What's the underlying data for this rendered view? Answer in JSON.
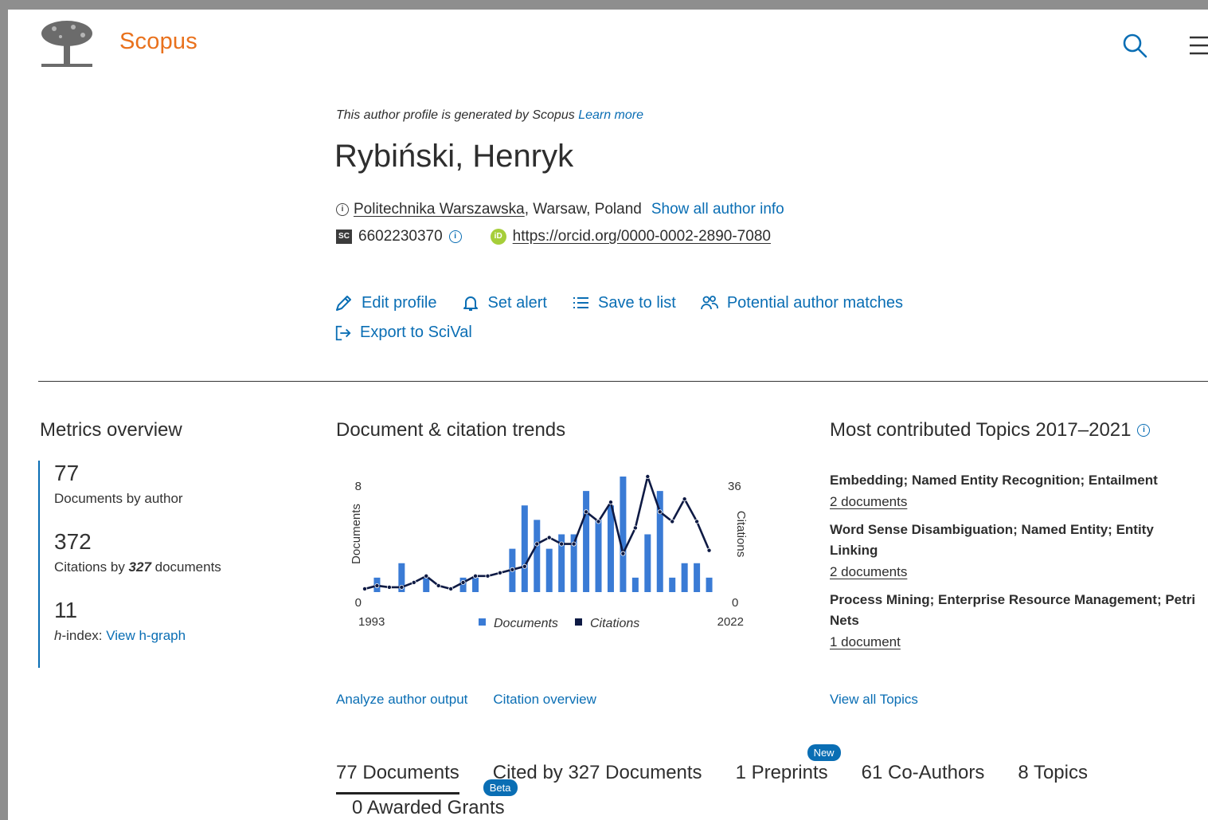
{
  "header": {
    "brand": "Scopus",
    "logo_icon": "elsevier-tree-logo",
    "search_icon": "search-icon",
    "menu_icon": "hamburger-menu-icon"
  },
  "profile": {
    "note": "This author profile is generated by Scopus",
    "learn_more": "Learn more",
    "name": "Rybiński, Henryk",
    "affiliation_link": "Politechnika Warszawska",
    "affiliation_rest": ", Warsaw, Poland",
    "show_all": "Show all author info",
    "scopus_id": "6602230370",
    "orcid": "https://orcid.org/0000-0002-2890-7080"
  },
  "actions": {
    "edit": "Edit profile",
    "alert": "Set alert",
    "save": "Save to list",
    "matches": "Potential author matches",
    "export": "Export to SciVal"
  },
  "metrics": {
    "title": "Metrics overview",
    "documents_value": "77",
    "documents_label": "Documents by author",
    "citations_value": "372",
    "citations_label_pre": "Citations by ",
    "citations_label_num": "327",
    "citations_label_post": " documents",
    "hindex_value": "11",
    "hindex_label_h": "h",
    "hindex_label_rest": "-index: ",
    "hindex_link": "View h-graph"
  },
  "chart_section": {
    "title": "Document & citation trends",
    "analyze_link": "Analyze author output",
    "citation_link": "Citation overview"
  },
  "chart_data": {
    "type": "bar",
    "title": "Document & citation trends",
    "x_start_label": "1993",
    "x_end_label": "2022",
    "years": [
      1993,
      1994,
      1995,
      1996,
      1997,
      1998,
      1999,
      2000,
      2001,
      2002,
      2003,
      2004,
      2005,
      2006,
      2007,
      2008,
      2009,
      2010,
      2011,
      2012,
      2013,
      2014,
      2015,
      2016,
      2017,
      2018,
      2019,
      2020,
      2021,
      2022
    ],
    "series": [
      {
        "name": "Documents",
        "axis": "left",
        "color": "#3a7bd5",
        "values": [
          0,
          1,
          0,
          2,
          0,
          1,
          0,
          0,
          1,
          1,
          0,
          0,
          3,
          6,
          5,
          3,
          4,
          4,
          7,
          5,
          6,
          8,
          1,
          4,
          7,
          1,
          2,
          2,
          1,
          0
        ]
      },
      {
        "name": "Citations",
        "axis": "right",
        "color": "#0e1a44",
        "values": [
          1,
          2,
          1.5,
          1.5,
          3,
          5,
          2,
          1,
          3,
          5,
          5,
          6,
          7,
          8,
          15,
          17,
          15,
          15,
          25,
          22,
          28,
          12,
          20,
          36,
          25,
          22,
          29,
          22,
          13,
          null
        ]
      }
    ],
    "ylabel_left": "Documents",
    "ylabel_right": "Citations",
    "ylim_left": [
      0,
      8
    ],
    "ylim_right": [
      0,
      36
    ],
    "left_ticks": [
      "0",
      "8"
    ],
    "right_ticks": [
      "0",
      "36"
    ],
    "legend": [
      "Documents",
      "Citations"
    ],
    "legend_position": "bottom",
    "grid": false
  },
  "topics": {
    "title": "Most contributed Topics 2017–2021",
    "items": [
      {
        "name": "Embedding; Named Entity Recognition; Entailment",
        "docs": "2 documents"
      },
      {
        "name": "Word Sense Disambiguation; Named Entity; Entity Linking",
        "docs": "2 documents"
      },
      {
        "name": "Process Mining; Enterprise Resource Management; Petri Nets",
        "docs": "1 document"
      }
    ],
    "view_all": "View all Topics"
  },
  "tabs": {
    "documents": "77 Documents",
    "cited_by": "Cited by 327 Documents",
    "preprints": "1 Preprints",
    "coauthors": "61 Co-Authors",
    "topics": "8 Topics",
    "grants": "0 Awarded Grants",
    "new_badge": "New",
    "beta_badge": "Beta"
  }
}
